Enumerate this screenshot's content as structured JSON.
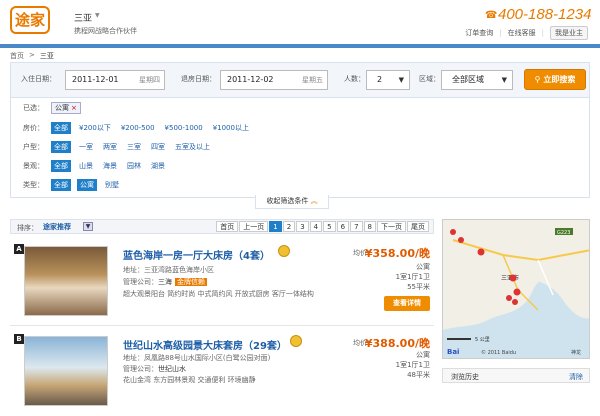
{
  "header": {
    "logo": "途家",
    "city": "三亚",
    "partner": "携程网战略合作伙伴",
    "phone": "400-188-1234",
    "links": [
      "订单查询",
      "在线客服"
    ],
    "owner_btn": "我是业主"
  },
  "breadcrumb": [
    "首页",
    ">",
    "三亚"
  ],
  "search": {
    "checkin_label": "入住日期：",
    "checkin_value": "2011-12-01",
    "checkin_weekday": "星期四",
    "checkout_label": "退房日期：",
    "checkout_value": "2011-12-02",
    "checkout_weekday": "星期五",
    "people_label": "人数：",
    "people_value": "2",
    "area_label": "区域：",
    "area_value": "全部区域",
    "button": "立即搜索"
  },
  "filters": {
    "chosen_label": "已选：",
    "chosen_tag": "公寓",
    "rows": [
      {
        "key": "房价：",
        "options": [
          "全部",
          "¥200以下",
          "¥200-500",
          "¥500-1000",
          "¥1000以上"
        ]
      },
      {
        "key": "户型：",
        "options": [
          "全部",
          "一室",
          "两室",
          "三室",
          "四室",
          "五室及以上"
        ]
      },
      {
        "key": "景观：",
        "options": [
          "全部",
          "山景",
          "海景",
          "园林",
          "湖景"
        ]
      },
      {
        "key": "类型：",
        "options": [
          "全部",
          "公寓",
          "别墅"
        ]
      }
    ],
    "collapse": "收起筛选条件"
  },
  "listing_header": {
    "sort_label": "排序：",
    "sort_value": "途家推荐",
    "pager": [
      "首页",
      "上一页",
      "1",
      "2",
      "3",
      "4",
      "5",
      "6",
      "7",
      "8",
      "下一页",
      "尾页"
    ]
  },
  "listings": [
    {
      "badge": "A",
      "title": "蓝色海岸一房一厅大床房（4套）",
      "address": "地址：三亚湾路蓝色海岸小区",
      "manager": "管理公司：",
      "manager_name": "三海",
      "manager_tag": "金牌信赖",
      "features": "超大观景阳台  简约时尚  中式简约风  开放式厨房  客厅一体结构",
      "price_label": "均价：",
      "price": "¥358.00/晚",
      "type": "公寓",
      "rooms": "1室1厅1卫",
      "size": "55平米",
      "detail": "查看详情"
    },
    {
      "badge": "B",
      "title": "世纪山水高级园景大床套房（29套）",
      "address": "地址：凤凰路88号山水国际小区(白鹭公园对面)",
      "manager": "管理公司：",
      "manager_name": "世纪山水",
      "features": "花山金湾  东方园林景观  交通便利  环境幽静",
      "price_label": "均价：",
      "price": "¥388.00/晚",
      "type": "公寓",
      "rooms": "1室1厅1卫",
      "size": "48平米"
    }
  ],
  "map": {
    "road": "G223",
    "district": "三亚市",
    "scale": "5 公里",
    "copyright": "© 2011 Baidu",
    "baidu": "Bai",
    "area": "神龙"
  },
  "history": {
    "title": "浏览历史",
    "clear": "清除"
  },
  "colors": {
    "brand": "#e87a00",
    "link": "#1f5fa8",
    "accent": "#1f7fc8"
  }
}
